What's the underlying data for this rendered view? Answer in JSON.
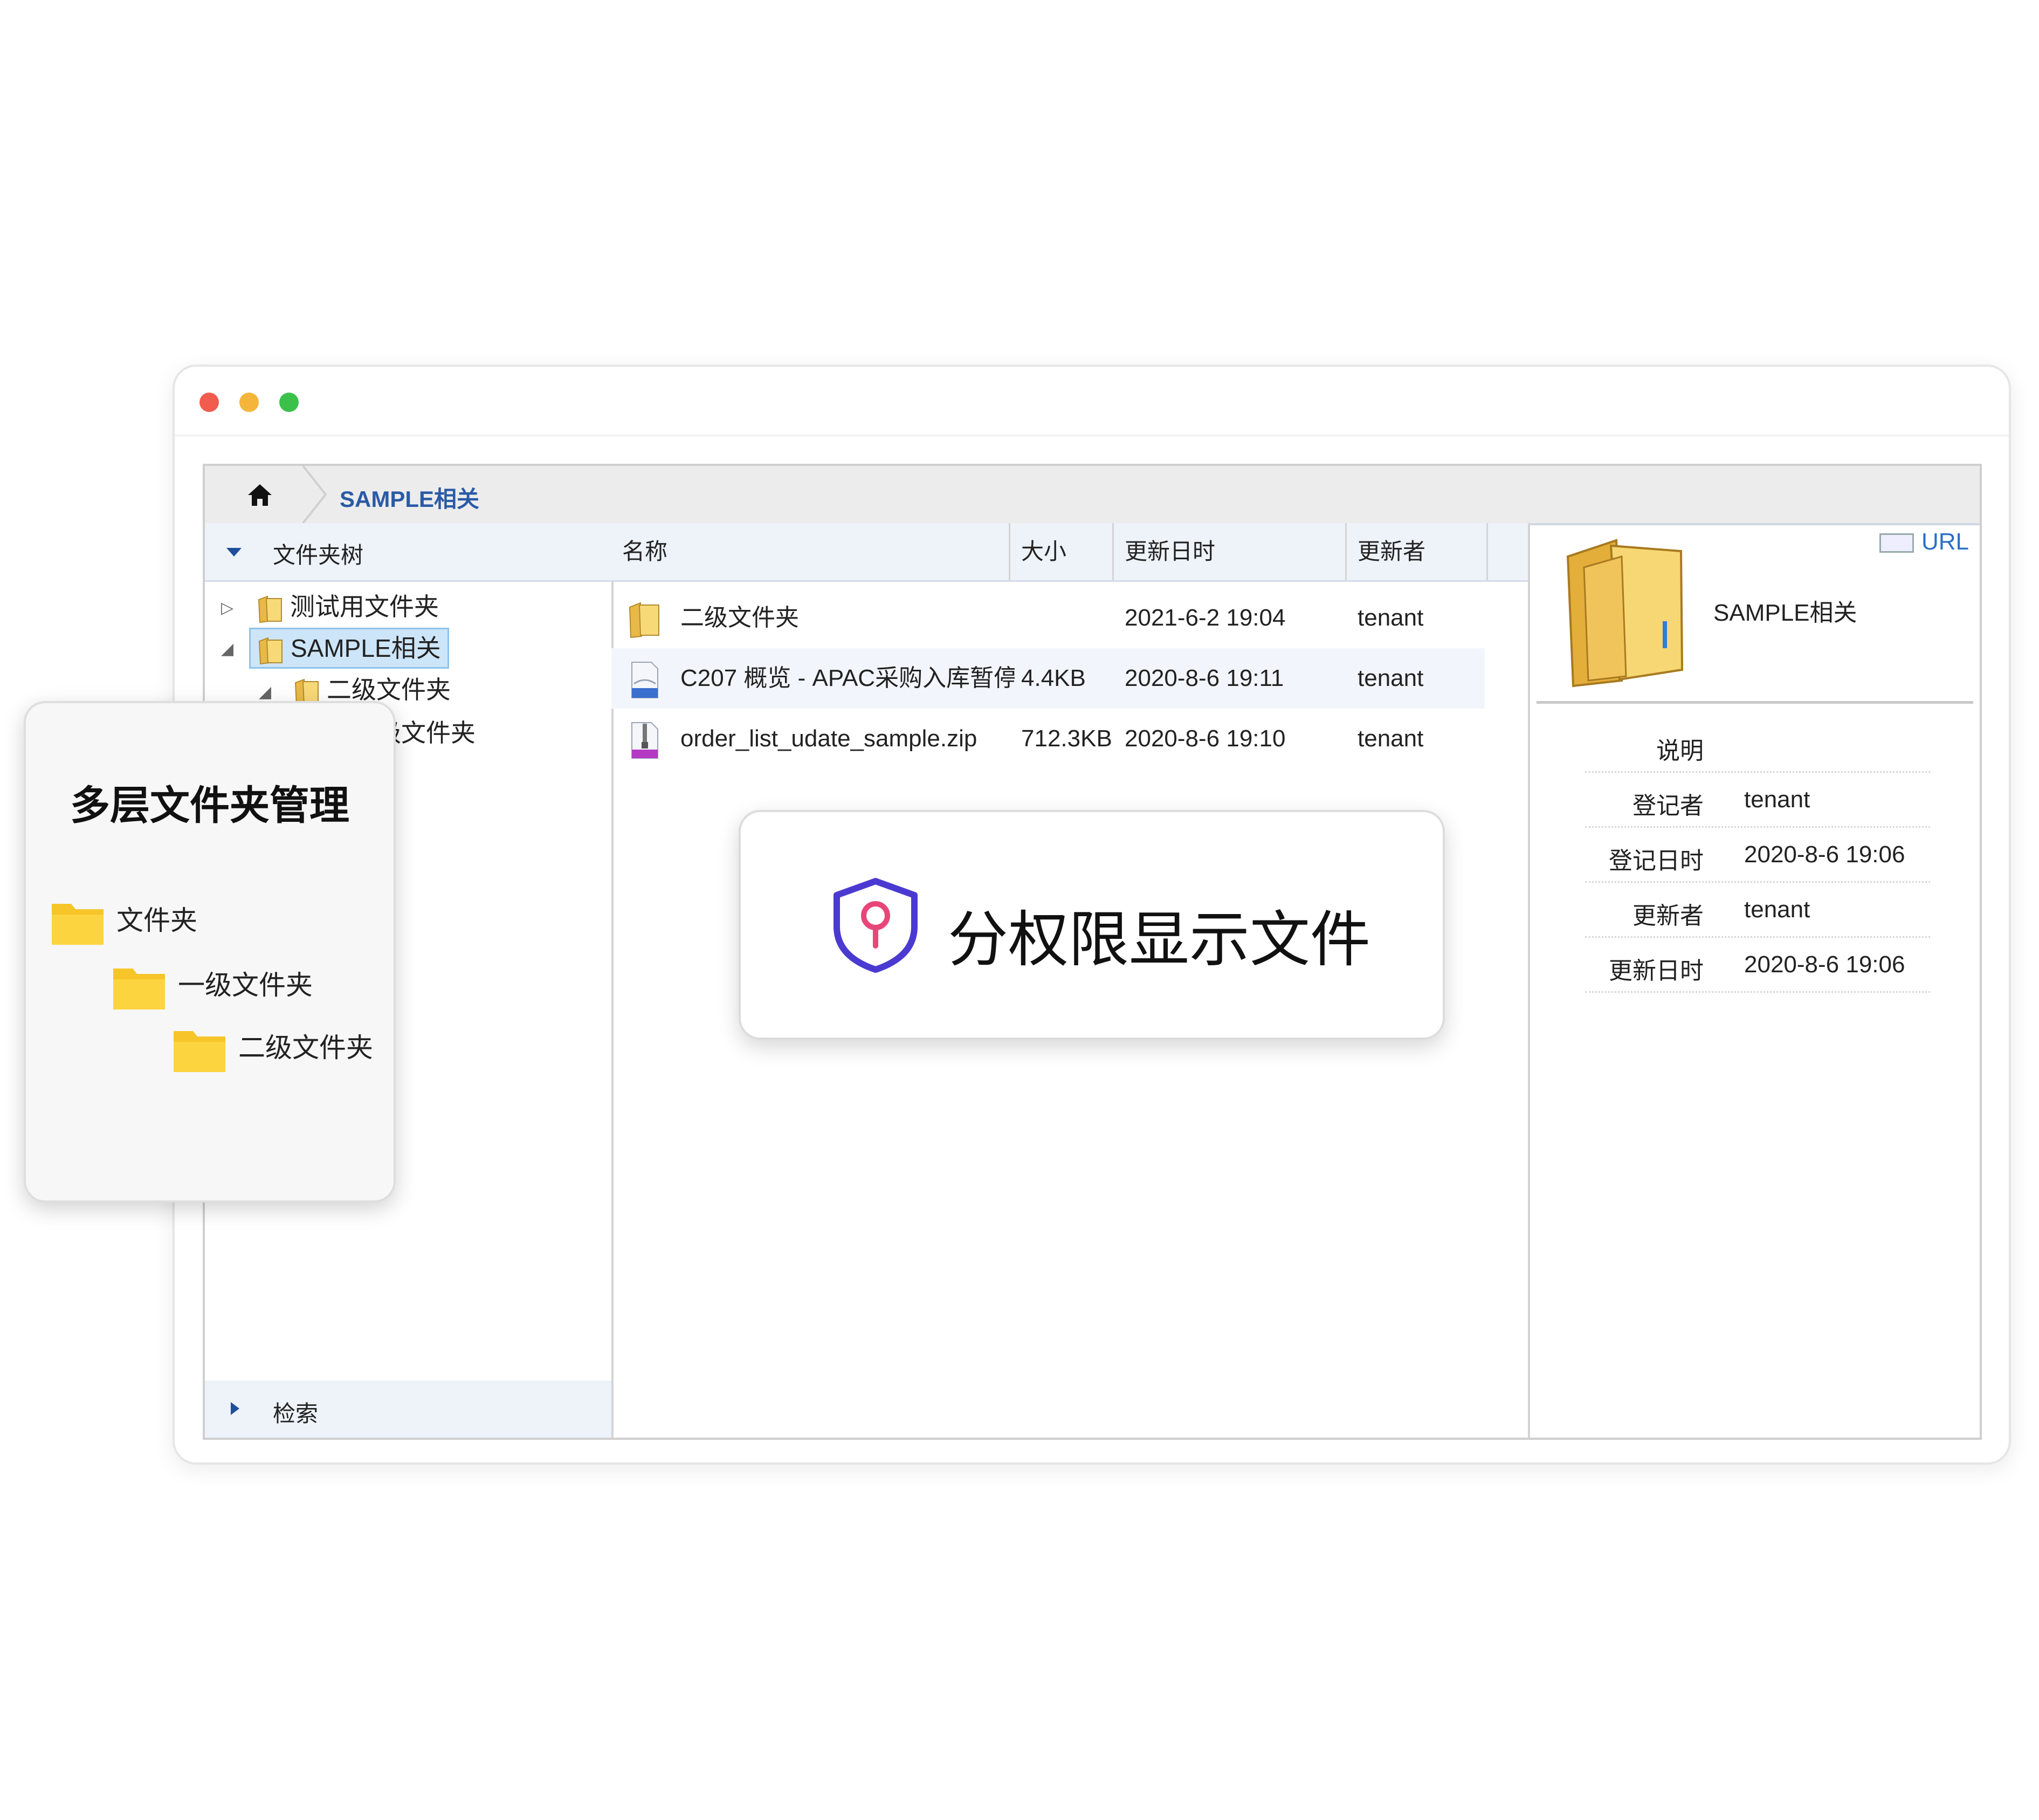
{
  "breadcrumb": {
    "current": "SAMPLE相关"
  },
  "tree": {
    "title": "文件夹树",
    "nodes": [
      {
        "label": "测试用文件夹"
      },
      {
        "label": "SAMPLE相关"
      },
      {
        "label": "二级文件夹"
      },
      {
        "label": "级文件夹"
      }
    ],
    "search_label": "检索"
  },
  "list": {
    "columns": [
      "名称",
      "大小",
      "更新日时",
      "更新者"
    ],
    "rows": [
      {
        "icon": "folder-icon",
        "name": "二级文件夹",
        "size": "",
        "updated": "2021-6-2 19:04",
        "by": "tenant"
      },
      {
        "icon": "document-icon",
        "name": "C207 概览 - APAC采购入库暂停",
        "size": "4.4KB",
        "updated": "2020-8-6 19:11",
        "by": "tenant"
      },
      {
        "icon": "zip-icon",
        "name": "order_list_udate_sample.zip",
        "size": "712.3KB",
        "updated": "2020-8-6 19:10",
        "by": "tenant"
      }
    ]
  },
  "detail": {
    "url_label": "URL",
    "name": "SAMPLE相关",
    "props": [
      {
        "key": "说明",
        "value": ""
      },
      {
        "key": "登记者",
        "value": "tenant"
      },
      {
        "key": "登记日时",
        "value": "2020-8-6 19:06"
      },
      {
        "key": "更新者",
        "value": "tenant"
      },
      {
        "key": "更新日时",
        "value": "2020-8-6 19:06"
      }
    ]
  },
  "card_left": {
    "title": "多层文件夹管理",
    "levels": [
      "文件夹",
      "一级文件夹",
      "二级文件夹"
    ]
  },
  "card_center": {
    "text": "分权限显示文件"
  },
  "colors": {
    "accent": "#2a5aa6",
    "shield": "#4b3ad1",
    "shield_key": "#e8467a",
    "folder_yellow": "#f6c52a"
  }
}
